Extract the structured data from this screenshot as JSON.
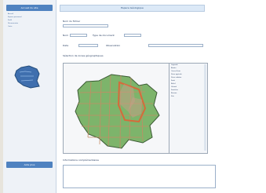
{
  "sidebar": {
    "header": "Accueil du site",
    "links": [
      "Accueil",
      "Espace personnel",
      "Profil",
      "Déconnexion",
      "Carte"
    ],
    "sections": [
      "Espace pro",
      "Aide plus"
    ],
    "more_links": [
      "Aide",
      "FAQ",
      "Contact",
      "Outils",
      "Mentions",
      "Plan",
      "Liens"
    ]
  },
  "main": {
    "page_title": "Espace Géologique",
    "field_1_label": "Nom du fichier",
    "field_2_label": "Nom",
    "field_3_label": "Type de document",
    "field_4_label": "Date",
    "field_5_label": "Observation",
    "field_6_label": "Coordonnées",
    "field_1_value": "",
    "field_2_value": "",
    "field_3_value": "",
    "field_4_value": "",
    "field_5_value": "",
    "field_6_value": "",
    "map_title": "Sélection de zones géographiques",
    "legend_title": "Légende",
    "legend_items": [
      "Bassin",
      "Cours d'eau",
      "Zone agricole",
      "Zone urbaine",
      "Forêt",
      "Relief",
      "Littoral",
      "Frontière",
      "Réseau",
      "Site"
    ],
    "footer_label": "Informations complémentaires"
  },
  "colors": {
    "accent": "#4f82c0",
    "map_green": "#7db46b",
    "map_border": "#c48c65",
    "highlight": "#d59a77"
  }
}
